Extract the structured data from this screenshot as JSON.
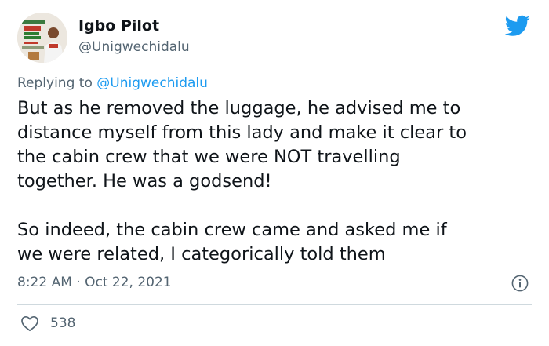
{
  "author": {
    "display_name": "Igbo Pilot",
    "handle": "@Unigwechidalu",
    "avatar_icon": "profile-photo-avatar"
  },
  "reply": {
    "prefix": "Replying to",
    "mention": "@Unigwechidalu"
  },
  "tweet": {
    "paragraph_1": "But as he removed the luggage, he advised me to\ndistance myself from this lady and make it clear to\nthe cabin crew that we were NOT travelling\ntogether. He was a godsend!",
    "paragraph_2": "So indeed, the cabin crew came and asked me if\nwe were related, I categorically told them"
  },
  "meta": {
    "time": "8:22 AM",
    "separator": "·",
    "date": "Oct 22, 2021"
  },
  "stats": {
    "likes": "538"
  },
  "icons": {
    "brand": "twitter-bird-icon",
    "info": "info-icon",
    "like": "heart-icon"
  },
  "colors": {
    "brand": "#1d9bf0",
    "secondary_text": "#536471",
    "primary_text": "#0f1419",
    "divider": "#cfd9de"
  }
}
